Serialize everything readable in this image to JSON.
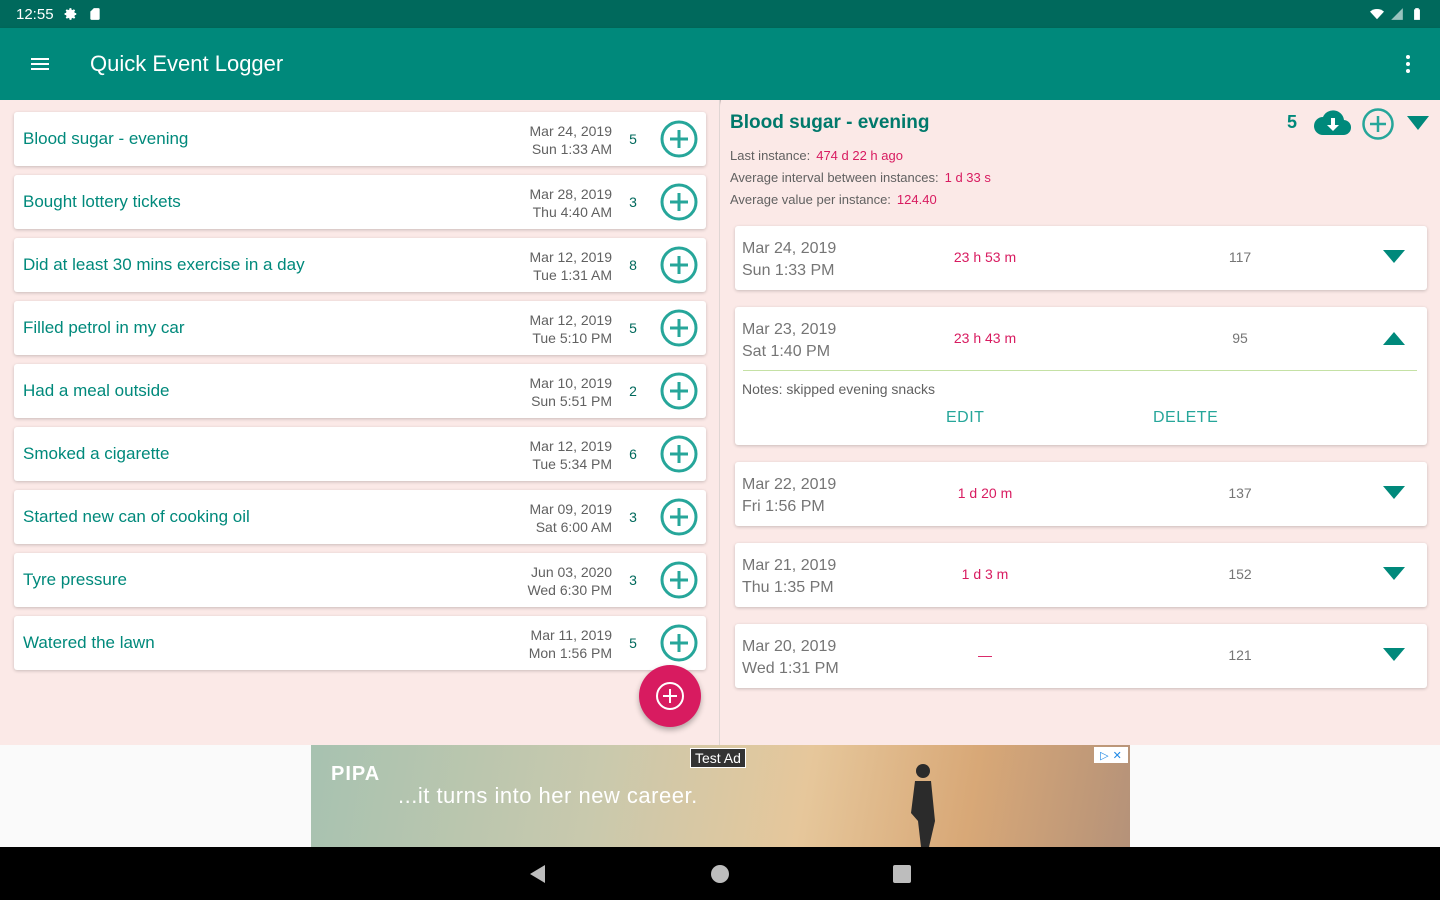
{
  "status_bar": {
    "time": "12:55"
  },
  "app_bar": {
    "title": "Quick Event Logger"
  },
  "events": [
    {
      "name": "Blood sugar - evening",
      "date": "Mar 24, 2019",
      "time": "Sun 1:33 AM",
      "count": "5"
    },
    {
      "name": "Bought lottery tickets",
      "date": "Mar 28, 2019",
      "time": "Thu 4:40 AM",
      "count": "3"
    },
    {
      "name": "Did at least 30 mins exercise in a day",
      "date": "Mar 12, 2019",
      "time": "Tue 1:31 AM",
      "count": "8"
    },
    {
      "name": "Filled petrol in my car",
      "date": "Mar 12, 2019",
      "time": "Tue 5:10 PM",
      "count": "5"
    },
    {
      "name": "Had a meal outside",
      "date": "Mar 10, 2019",
      "time": "Sun 5:51 PM",
      "count": "2"
    },
    {
      "name": "Smoked a cigarette",
      "date": "Mar 12, 2019",
      "time": "Tue 5:34 PM",
      "count": "6"
    },
    {
      "name": "Started new can of cooking oil",
      "date": "Mar 09, 2019",
      "time": "Sat 6:00 AM",
      "count": "3"
    },
    {
      "name": "Tyre pressure",
      "date": "Jun 03, 2020",
      "time": "Wed 6:30 PM",
      "count": "3"
    },
    {
      "name": "Watered the lawn",
      "date": "Mar 11, 2019",
      "time": "Mon 1:56 PM",
      "count": "5"
    }
  ],
  "detail": {
    "title": "Blood sugar - evening",
    "count": "5",
    "last_instance_label": "Last instance:",
    "last_instance_value": "474 d 22 h ago",
    "avg_interval_label": "Average interval between instances:",
    "avg_interval_value": "1 d 33 s",
    "avg_value_label": "Average value per instance:",
    "avg_value_value": "124.40",
    "instances": [
      {
        "date": "Mar 24, 2019",
        "time": "Sun 1:33 PM",
        "interval": "23 h 53 m",
        "value": "117",
        "expanded": false
      },
      {
        "date": "Mar 23, 2019",
        "time": "Sat 1:40 PM",
        "interval": "23 h 43 m",
        "value": "95",
        "expanded": true,
        "notes": "Notes: skipped evening snacks",
        "edit_label": "EDIT",
        "delete_label": "DELETE"
      },
      {
        "date": "Mar 22, 2019",
        "time": "Fri 1:56 PM",
        "interval": "1 d 20 m",
        "value": "137",
        "expanded": false
      },
      {
        "date": "Mar 21, 2019",
        "time": "Thu 1:35 PM",
        "interval": "1 d 3 m",
        "value": "152",
        "expanded": false
      },
      {
        "date": "Mar 20, 2019",
        "time": "Wed 1:31 PM",
        "interval": "—",
        "value": "121",
        "expanded": false
      }
    ]
  },
  "ad": {
    "logo": "PIPA",
    "text": "...it turns into her new career.",
    "label": "Test Ad"
  },
  "icons": {
    "menu": "hamburger-menu-icon",
    "overflow": "more-vert-icon",
    "add": "add-circle-outline-icon",
    "cloud": "cloud-download-icon",
    "expand": "arrow-drop-down-icon",
    "collapse": "arrow-drop-up-icon"
  },
  "colors": {
    "primary": "#00897b",
    "primary_dark": "#00695c",
    "accent": "#d81b60",
    "background": "#fbe9e7"
  }
}
